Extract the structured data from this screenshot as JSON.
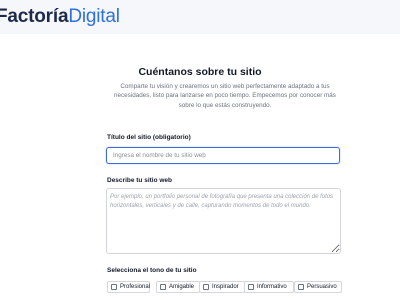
{
  "header": {
    "logo_part1": "Factoría",
    "logo_part2": "Digital"
  },
  "main": {
    "title": "Cuéntanos sobre tu sitio",
    "intro": "Comparte tu visión y crearemos un sitio web perfectamente adaptado a tus necesidades, listo para lanzarse en poco tiempo. Empecemos por conocer más sobre lo que estás construyendo.",
    "site_title": {
      "label": "Título del sitio (obligatorio)",
      "placeholder": "Ingresa el nombre de tu sitio web",
      "value": ""
    },
    "description": {
      "label": "Describe tu sitio web",
      "placeholder": "Por ejemplo, un portfolio personal de fotografía que presenta una colección de fotos horizontales, verticales y de calle, capturando momentos de todo el mundo."
    },
    "tone": {
      "label": "Selecciona el tono de tu sitio",
      "options": [
        "Profesional",
        "Amigable",
        "Inspirador",
        "Informativo",
        "Persuasivo"
      ]
    }
  }
}
